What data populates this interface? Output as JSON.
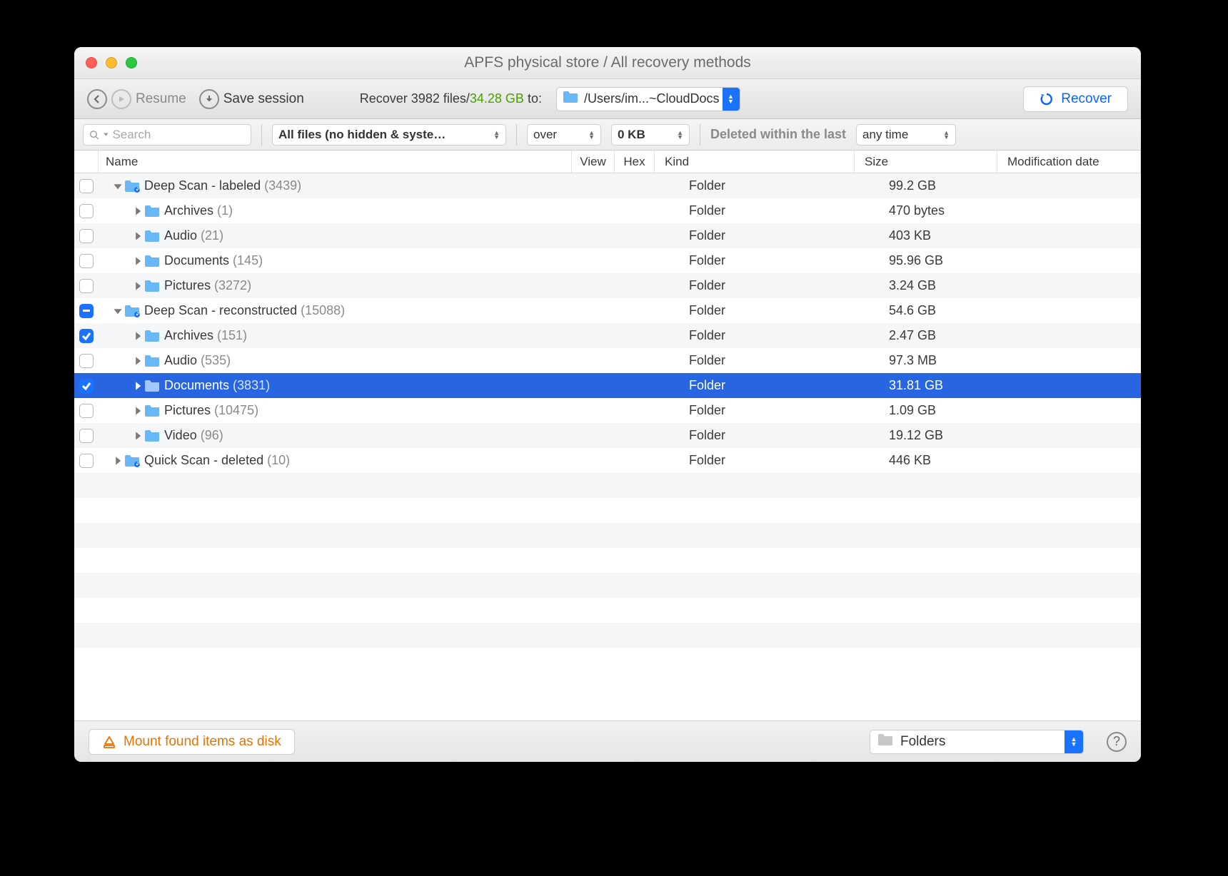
{
  "title": "APFS physical store / All recovery methods",
  "toolbar": {
    "resume_label": "Resume",
    "save_session_label": "Save session",
    "recover_prefix": "Recover ",
    "recover_count": "3982 files",
    "recover_slash": "/",
    "recover_size": "34.28 GB",
    "recover_to": " to:",
    "dest_path": "/Users/im...~CloudDocs",
    "recover_button": "Recover"
  },
  "filter": {
    "search_placeholder": "Search",
    "all_files": "All files (no hidden & syste…",
    "over": "over",
    "size": "0 KB",
    "deleted_label": "Deleted within the last",
    "time": "any time"
  },
  "columns": {
    "name": "Name",
    "view": "View",
    "hex": "Hex",
    "kind": "Kind",
    "size": "Size",
    "mod": "Modification date"
  },
  "rows": [
    {
      "depth": 0,
      "expanded": true,
      "check": "off",
      "name": "Deep Scan - labeled",
      "count": "3439",
      "kind": "Folder",
      "size": "99.2 GB",
      "scan": true
    },
    {
      "depth": 1,
      "expanded": false,
      "check": "off",
      "name": "Archives",
      "count": "1",
      "kind": "Folder",
      "size": "470 bytes"
    },
    {
      "depth": 1,
      "expanded": false,
      "check": "off",
      "name": "Audio",
      "count": "21",
      "kind": "Folder",
      "size": "403 KB"
    },
    {
      "depth": 1,
      "expanded": false,
      "check": "off",
      "name": "Documents",
      "count": "145",
      "kind": "Folder",
      "size": "95.96 GB"
    },
    {
      "depth": 1,
      "expanded": false,
      "check": "off",
      "name": "Pictures",
      "count": "3272",
      "kind": "Folder",
      "size": "3.24 GB"
    },
    {
      "depth": 0,
      "expanded": true,
      "check": "mixed",
      "name": "Deep Scan - reconstructed",
      "count": "15088",
      "kind": "Folder",
      "size": "54.6 GB",
      "scan": true
    },
    {
      "depth": 1,
      "expanded": false,
      "check": "checked",
      "name": "Archives",
      "count": "151",
      "kind": "Folder",
      "size": "2.47 GB"
    },
    {
      "depth": 1,
      "expanded": false,
      "check": "off",
      "name": "Audio",
      "count": "535",
      "kind": "Folder",
      "size": "97.3 MB"
    },
    {
      "depth": 1,
      "expanded": false,
      "check": "checked",
      "name": "Documents",
      "count": "3831",
      "kind": "Folder",
      "size": "31.81 GB",
      "selected": true
    },
    {
      "depth": 1,
      "expanded": false,
      "check": "off",
      "name": "Pictures",
      "count": "10475",
      "kind": "Folder",
      "size": "1.09 GB"
    },
    {
      "depth": 1,
      "expanded": false,
      "check": "off",
      "name": "Video",
      "count": "96",
      "kind": "Folder",
      "size": "19.12 GB"
    },
    {
      "depth": 0,
      "expanded": false,
      "check": "off",
      "name": "Quick Scan - deleted",
      "count": "10",
      "kind": "Folder",
      "size": "446 KB",
      "scan": true
    }
  ],
  "footer": {
    "mount_label": "Mount found items as disk",
    "view_mode": "Folders"
  }
}
